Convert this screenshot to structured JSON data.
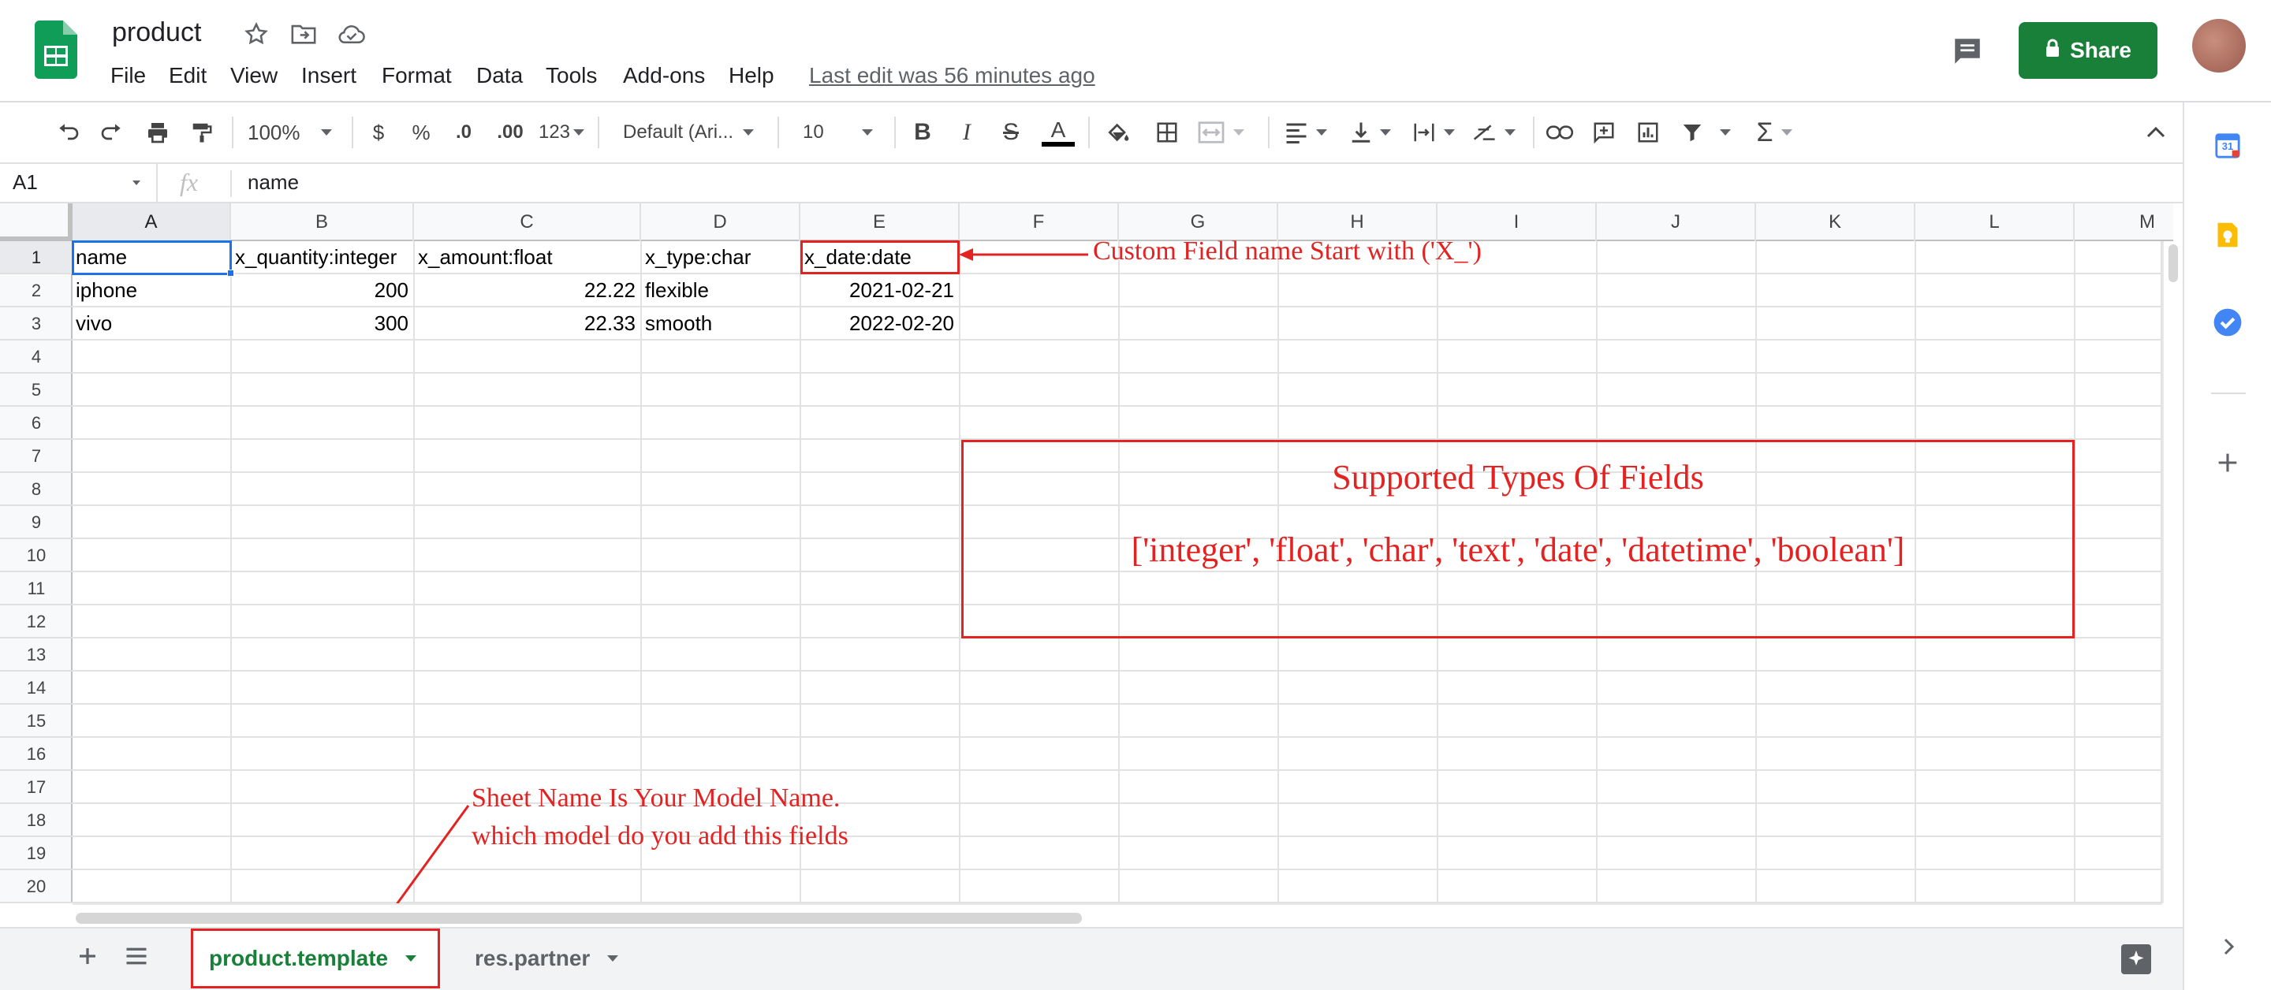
{
  "app": {
    "doc_title": "product",
    "menu": [
      "File",
      "Edit",
      "View",
      "Insert",
      "Format",
      "Data",
      "Tools",
      "Add-ons",
      "Help"
    ],
    "last_edit": "Last edit was 56 minutes ago",
    "share_label": "Share",
    "brand_green": "#188038"
  },
  "toolbar": {
    "zoom": "100%",
    "currency": "$",
    "percent": "%",
    "decrease_decimals": ".0",
    "increase_decimals": ".00",
    "more_formats": "123",
    "font": "Default (Ari...",
    "font_size": "10",
    "bold": "B",
    "italic": "I",
    "strikethrough": "S",
    "text_color": "A",
    "sum": "Σ"
  },
  "formula_bar": {
    "cell_ref": "A1",
    "fx": "fx",
    "value": "name"
  },
  "columns": [
    "A",
    "B",
    "C",
    "D",
    "E",
    "F",
    "G",
    "H",
    "I",
    "J",
    "K",
    "L",
    "M"
  ],
  "rows": [
    "1",
    "2",
    "3",
    "4",
    "5",
    "6",
    "7",
    "8",
    "9",
    "10",
    "11",
    "12",
    "13",
    "14",
    "15",
    "16",
    "17",
    "18",
    "19",
    "20"
  ],
  "grid": [
    [
      "name",
      "x_quantity:integer",
      "x_amount:float",
      "x_type:char",
      "x_date:date"
    ],
    [
      "iphone",
      "200",
      "22.22",
      "flexible",
      "2021-02-21"
    ],
    [
      "vivo",
      "300",
      "22.33",
      "smooth",
      "2022-02-20"
    ]
  ],
  "annotations": {
    "custom_field": "Custom Field name Start with ('X_')",
    "types_title": "Supported Types Of Fields",
    "types_list": "['integer', 'float', 'char', 'text', 'date', 'datetime', 'boolean']",
    "sheet_note_1": "Sheet Name Is Your Model Name.",
    "sheet_note_2": "which model do you add this fields",
    "color": "#e32222"
  },
  "tabs": [
    {
      "label": "product.template",
      "active": true
    },
    {
      "label": "res.partner",
      "active": false
    }
  ],
  "side_panel": {
    "calendar_day": "31"
  },
  "icons": [
    "undo-icon",
    "redo-icon",
    "print-icon",
    "paint-format-icon",
    "fill-color-icon",
    "borders-icon",
    "merge-icon",
    "align-icon",
    "valign-icon",
    "wrap-icon",
    "rotate-icon",
    "link-icon",
    "comment-icon",
    "chart-icon",
    "filter-icon",
    "sum-icon",
    "collapse-icon",
    "star-icon",
    "move-icon",
    "cloud-icon",
    "comments-icon",
    "lock-icon",
    "add-sheet-icon",
    "all-sheets-icon",
    "explore-icon",
    "calendar-icon",
    "keep-icon",
    "tasks-icon",
    "plus-icon",
    "expand-icon"
  ]
}
